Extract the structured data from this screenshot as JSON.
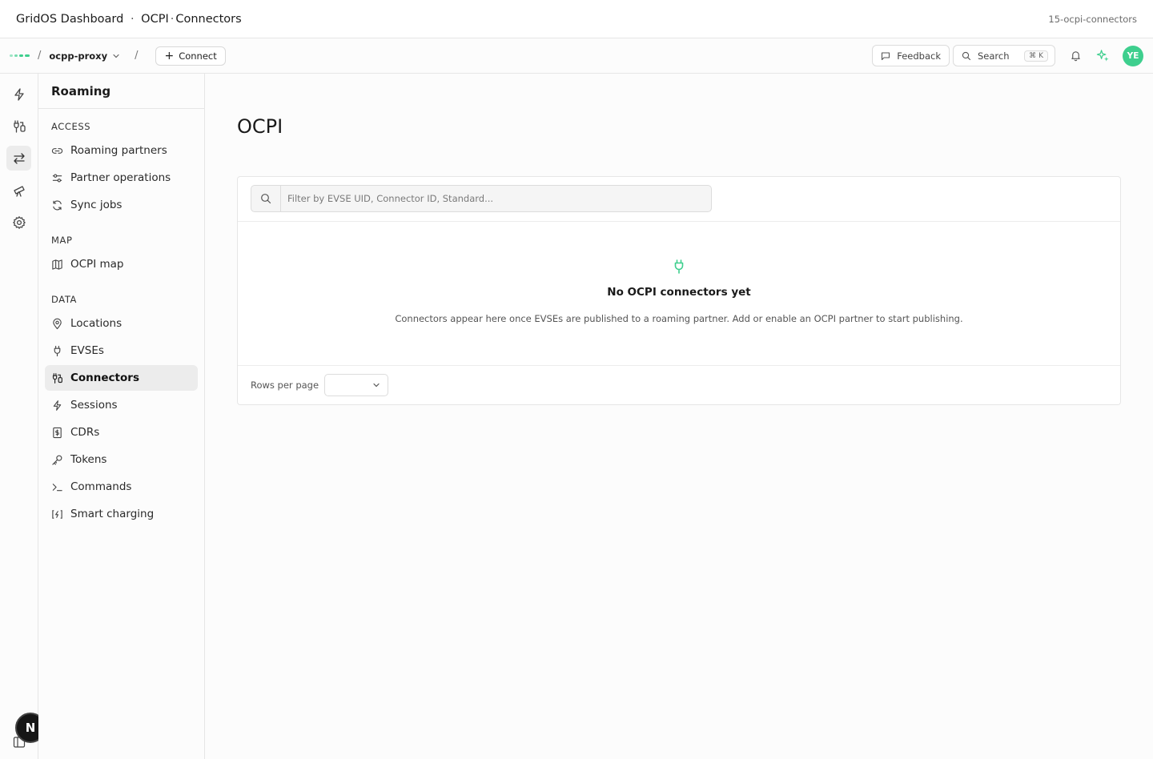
{
  "window": {
    "title_app": "GridOS Dashboard",
    "title_section": "OCPI",
    "title_page": "Connectors",
    "slug": "15-ocpi-connectors"
  },
  "topbar": {
    "crumb_sep": "/",
    "project": "ocpp-proxy",
    "connect_label": "Connect",
    "feedback_label": "Feedback",
    "search_label": "Search",
    "search_kbd_1": "⌘",
    "search_kbd_2": "K",
    "avatar_initials": "YE"
  },
  "rail": {
    "items": [
      "bolt-icon",
      "connector-icon",
      "arrows-icon",
      "telescope-icon",
      "gear-icon"
    ],
    "active_index": 2,
    "bottom_badge": "N"
  },
  "sidebar": {
    "title": "Roaming",
    "sections": [
      {
        "label": "ACCESS",
        "items": [
          "Roaming partners",
          "Partner operations",
          "Sync jobs"
        ]
      },
      {
        "label": "MAP",
        "items": [
          "OCPI map"
        ]
      },
      {
        "label": "DATA",
        "items": [
          "Locations",
          "EVSEs",
          "Connectors",
          "Sessions",
          "CDRs",
          "Tokens",
          "Commands",
          "Smart charging"
        ]
      }
    ],
    "active_item": "Connectors"
  },
  "main": {
    "page_title": "OCPI",
    "filter_placeholder": "Filter by EVSE UID, Connector ID, Standard...",
    "empty_title": "No OCPI connectors yet",
    "empty_description": "Connectors appear here once EVSEs are published to a roaming partner. Add or enable an OCPI partner to start publishing.",
    "rows_per_page_label": "Rows per page",
    "rows_per_page_value": ""
  },
  "colors": {
    "accent": "#3ecf8e",
    "background": "#fcfcfc",
    "border": "#e6e6e6"
  }
}
